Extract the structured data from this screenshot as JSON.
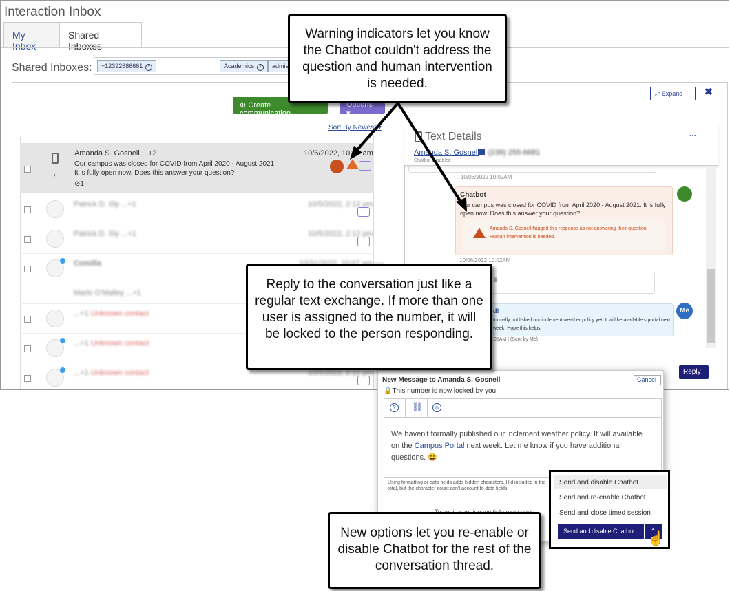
{
  "app": {
    "title": "Interaction Inbox"
  },
  "tabs": [
    {
      "label": "My Inbox"
    },
    {
      "label": "Shared Inboxes"
    }
  ],
  "shared": {
    "label": "Shared Inboxes:",
    "chips": [
      {
        "label": "+12392686661"
      },
      {
        "label": "Academics"
      },
      {
        "label": "admis"
      }
    ]
  },
  "toolbar": {
    "create_label": "Create communication",
    "options_label": "Options",
    "sort_label": "Sort By Newest"
  },
  "list": {
    "selected": {
      "name": "Amanda S. Gosnell ...+2",
      "date": "10/6/2022, 10:02 am",
      "preview": "Our campus was closed for COVID from April 2020 - August 2021. It is fully open now. Does this answer your question?",
      "attachments": "1"
    },
    "rows": [
      {
        "name": "Patrick D. Sly ...+1",
        "date": "10/5/2022, 2:12 pm"
      },
      {
        "name": "Patrick D. Sly ...+1",
        "date": "10/5/2022, 2:12 pm"
      },
      {
        "name": "Comilla",
        "date": "10/31/2022, 10:07 am"
      },
      {
        "name": "Marlo O'Malley ...+1",
        "date": ""
      },
      {
        "name": "...+1",
        "sub": "Unknown contact",
        "date": "10/5/2022, 2:12 pm"
      },
      {
        "name": "...+1",
        "sub": "Unknown contact",
        "date": "10/5/2022, 2:12 pm"
      },
      {
        "name": "...+1",
        "sub": "Unknown contact",
        "date": "10/5/2022, 2:12 pm"
      }
    ]
  },
  "details": {
    "title": "Text Details",
    "contact": "Amanda S. Gosnell",
    "phone": "(239) 255-6681",
    "chatbot_status": "Chatbot Disabled",
    "more": "...",
    "expand_label": "Expand",
    "ts1": "10/06/2022 10:02AM",
    "bot_name": "Chatbot",
    "bot_msg": "Our campus was closed for COVID from April 2020 - August 2021. It is fully open now. Does this answer your question?",
    "warning": "Amanda S. Gosnell flagged this response as not answering their question. Human intervention is needed.",
    "ts2": "10/06/2022 10:02AM",
    "reply_partial": "ll",
    "me_partial_head": "d!",
    "me_partial": "formally published our inclement weather policy yet. It will be available s portal next week. Hope this helps!",
    "me_ts": ":05AM | (Sent by Me)",
    "me_label": "Me",
    "reply_label": "Reply"
  },
  "composer": {
    "title": "New Message to Amanda S. Gosnell",
    "cancel": "Cancel",
    "lock_text": "This number is now locked by you.",
    "msg_part1": "We haven't formally published our inclement weather policy. It will available on the ",
    "msg_link": "Campus Portal",
    "msg_part2": " next week. Let me know if you have additional questions.",
    "emoji": "😀",
    "hint": "Using formatting or data fields adds hidden characters. Hid included in the total, but the character count can't account fo data fields.",
    "hint2": "To avoid sending multiple messages...",
    "options": [
      "Send and disable Chatbot",
      "Send and re-enable Chatbot",
      "Send and close timed session"
    ],
    "send_label": "Send and disable Chatbot"
  },
  "callouts": {
    "warning": "Warning indicators let you know the Chatbot couldn't address the question and human intervention is needed.",
    "reply": "Reply to the conversation just like a regular text exchange. If more than one user is assigned to the number, it will be locked to the person responding.",
    "options": "New options let you re-enable or disable Chatbot for the rest of the conversation thread."
  },
  "colors": {
    "accent": "#2a4b9b",
    "green": "#3d8a2c",
    "purple": "#7a6ad0",
    "navy": "#1f1f7a",
    "warning": "#c8501e"
  }
}
